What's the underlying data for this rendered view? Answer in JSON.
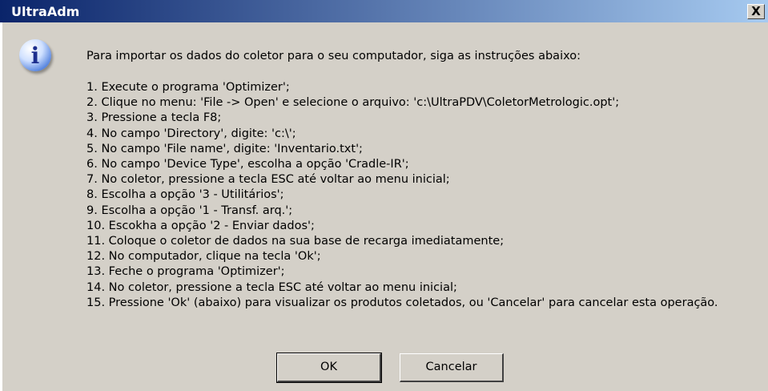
{
  "window": {
    "title": "UltraAdm",
    "close_label": "X"
  },
  "icon": {
    "name": "info-icon",
    "glyph": "i"
  },
  "message": {
    "intro": "Para importar os dados do coletor para o seu computador, siga as instruções abaixo:",
    "steps": [
      "1. Execute o programa 'Optimizer';",
      "2. Clique no menu: 'File -> Open' e selecione o arquivo: 'c:\\UltraPDV\\ColetorMetrologic.opt';",
      "3. Pressione a tecla F8;",
      "4. No campo 'Directory', digite: 'c:\\';",
      "5. No campo 'File name', digite: 'Inventario.txt';",
      "6. No campo 'Device Type', escolha a opção 'Cradle-IR';",
      "7. No coletor, pressione a tecla ESC até voltar ao menu inicial;",
      "8. Escolha a opção '3 - Utilitários';",
      "9. Escolha a opção '1 - Transf. arq.';",
      "10. Escokha a opção '2 - Enviar dados';",
      "11. Coloque o coletor de dados na sua base de recarga imediatamente;",
      "12. No computador, clique na tecla 'Ok';",
      "13. Feche o programa 'Optimizer';",
      "14. No coletor, pressione a tecla ESC até voltar ao menu inicial;",
      "15. Pressione 'Ok' (abaixo) para visualizar os produtos coletados, ou 'Cancelar' para cancelar esta operação."
    ]
  },
  "buttons": {
    "ok": "OK",
    "cancel": "Cancelar"
  }
}
